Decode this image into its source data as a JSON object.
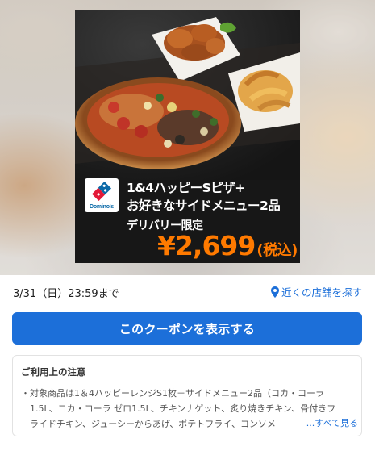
{
  "ad": {
    "logo_text": "Domino's",
    "headline_1": "1&4ハッピーSピザ+",
    "headline_2": "お好きなサイドメニュー2品",
    "subline": "デリバリー限定",
    "price": "¥2,699",
    "tax_label": "(税込)",
    "price_color": "#ff7a00",
    "logo_colors": {
      "blue": "#0b6aa8",
      "red": "#e31837"
    }
  },
  "coupon": {
    "deadline": "3/31（日）23:59まで",
    "nearby_label": "近くの店舗を探す",
    "nearby_icon": "location-pin-icon",
    "show_button_label": "このクーポンを表示する",
    "accent_color": "#1c6fd9"
  },
  "notes": {
    "title": "ご利用上の注意",
    "lines": [
      "・対象商品は1＆4ハッピーレンジS1枚＋サイドメニュー2品（コカ・コーラ",
      "　1.5L、コカ・コーラ ゼロ1.5L、チキンナゲット、炙り焼きチキン、骨付きフ",
      "　ライドチキン、ジューシーからあげ、ポテトフライ、コンソメ"
    ],
    "more_label": "...すべて見る"
  }
}
